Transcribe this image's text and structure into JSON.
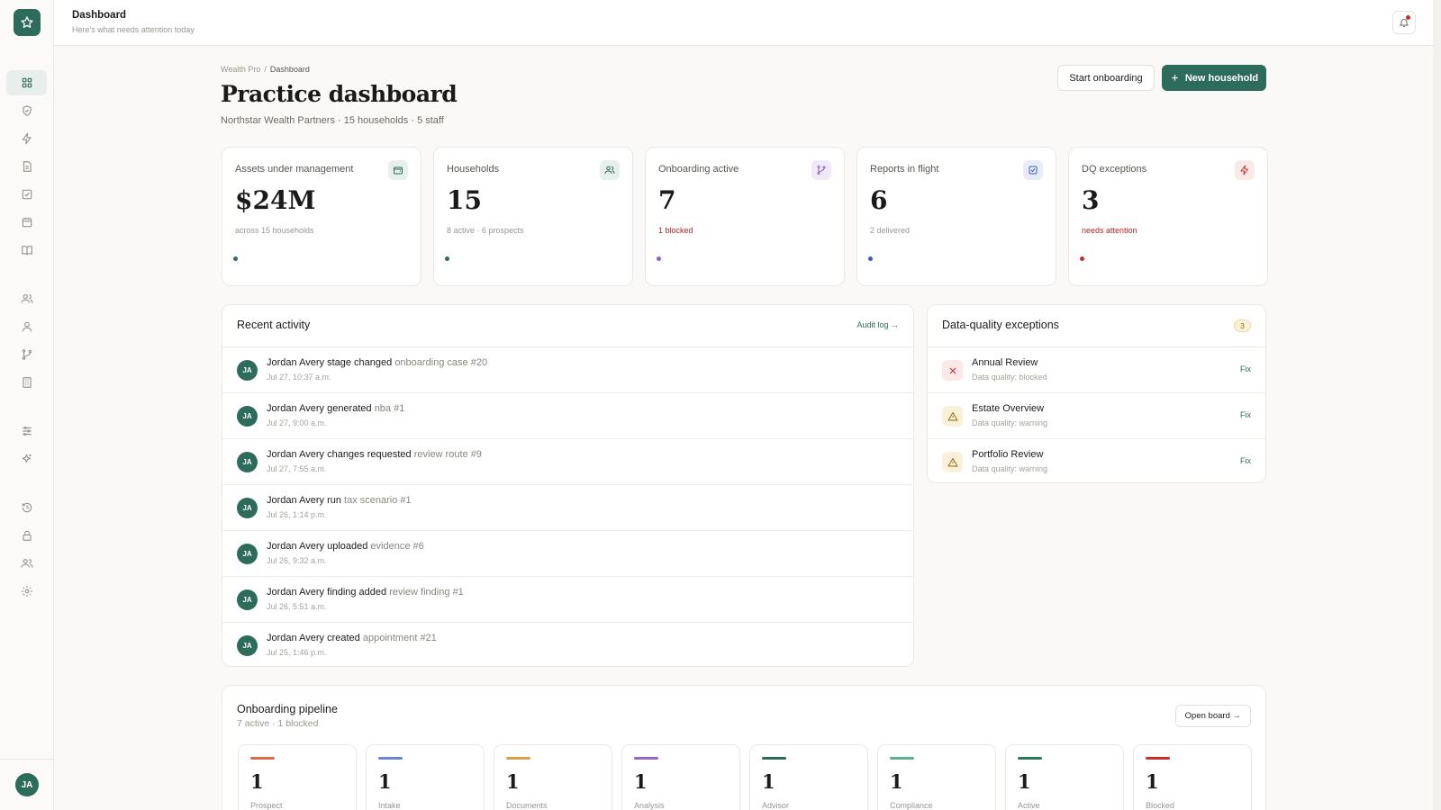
{
  "topbar": {
    "title": "Dashboard",
    "subtitle": "Here's what needs attention today"
  },
  "sidebar": {
    "items": [
      {
        "icon": "grid-icon"
      },
      {
        "icon": "shield-icon"
      },
      {
        "icon": "bolt-icon"
      },
      {
        "icon": "document-icon"
      },
      {
        "icon": "checkbox-icon"
      },
      {
        "icon": "calendar-icon"
      },
      {
        "icon": "book-icon"
      },
      {
        "icon": "users-icon"
      },
      {
        "icon": "user-icon"
      },
      {
        "icon": "branch-icon"
      },
      {
        "icon": "building-icon"
      },
      {
        "icon": "sliders-icon"
      },
      {
        "icon": "sparkles-icon"
      },
      {
        "icon": "history-icon"
      },
      {
        "icon": "lock-icon"
      },
      {
        "icon": "team-icon"
      },
      {
        "icon": "gear-icon"
      }
    ],
    "avatar_initials": "JA"
  },
  "header": {
    "breadcrumb": [
      "Wealth Pro",
      "Dashboard"
    ],
    "title": "Practice dashboard",
    "subtitle": "Northstar Wealth Partners · 15 households · 5 staff",
    "start_onboarding_label": "Start onboarding",
    "new_household_label": "New household"
  },
  "kpis": [
    {
      "label": "Assets under management",
      "value": "$24M",
      "note": "across 15 households",
      "accent": "#2d6b5a",
      "icon": "wallet-icon"
    },
    {
      "label": "Households",
      "value": "15",
      "note": "8 active · 6 prospects",
      "accent": "#2d6b5a",
      "icon": "users-icon"
    },
    {
      "label": "Onboarding active",
      "value": "7",
      "note": "1 blocked",
      "accent": "#8b63c9",
      "icon": "branch-icon"
    },
    {
      "label": "Reports in flight",
      "value": "6",
      "note": "2 delivered",
      "accent": "#3a5fc4",
      "icon": "checkbox-icon"
    },
    {
      "label": "DQ exceptions",
      "value": "3",
      "note": "needs attention",
      "accent": "#c9302c",
      "icon": "bolt-icon"
    }
  ],
  "activity": {
    "title": "Recent activity",
    "audit_link": "Audit log →",
    "items": [
      {
        "initials": "JA",
        "actor": "Jordan Avery",
        "action": "stage changed",
        "target": "onboarding case #20",
        "time": "Jul 27, 10:37 a.m."
      },
      {
        "initials": "JA",
        "actor": "Jordan Avery",
        "action": "generated",
        "target": "nba #1",
        "time": "Jul 27, 9:00 a.m."
      },
      {
        "initials": "JA",
        "actor": "Jordan Avery",
        "action": "changes requested",
        "target": "review route #9",
        "time": "Jul 27, 7:55 a.m."
      },
      {
        "initials": "JA",
        "actor": "Jordan Avery",
        "action": "run",
        "target": "tax scenario #1",
        "time": "Jul 26, 1:14 p.m."
      },
      {
        "initials": "JA",
        "actor": "Jordan Avery",
        "action": "uploaded",
        "target": "evidence #6",
        "time": "Jul 26, 9:32 a.m."
      },
      {
        "initials": "JA",
        "actor": "Jordan Avery",
        "action": "finding added",
        "target": "review finding #1",
        "time": "Jul 26, 5:51 a.m."
      },
      {
        "initials": "JA",
        "actor": "Jordan Avery",
        "action": "created",
        "target": "appointment #21",
        "time": "Jul 25, 1:46 p.m."
      }
    ]
  },
  "dq": {
    "title": "Data-quality exceptions",
    "count": "3",
    "fix_label": "Fix",
    "items": [
      {
        "name": "Annual Review",
        "status": "Data quality: blocked",
        "severity": "blocked",
        "icon": "x-icon"
      },
      {
        "name": "Estate Overview",
        "status": "Data quality: warning",
        "severity": "warning",
        "icon": "warning-icon"
      },
      {
        "name": "Portfolio Review",
        "status": "Data quality: warning",
        "severity": "warning",
        "icon": "warning-icon"
      }
    ]
  },
  "pipeline": {
    "title": "Onboarding pipeline",
    "subtitle": "7 active · 1 blocked",
    "open_board_label": "Open board →",
    "stages": [
      {
        "name": "Prospect",
        "count": "1",
        "color": "#d96a4a"
      },
      {
        "name": "Intake",
        "count": "1",
        "color": "#6a84d6"
      },
      {
        "name": "Documents",
        "count": "1",
        "color": "#d9a04a"
      },
      {
        "name": "Analysis",
        "count": "1",
        "color": "#9466c9"
      },
      {
        "name": "Advisor",
        "count": "1",
        "color": "#2d6b5a"
      },
      {
        "name": "Compliance",
        "count": "1",
        "color": "#5fb08e"
      },
      {
        "name": "Active",
        "count": "1",
        "color": "#2d7a55"
      },
      {
        "name": "Blocked",
        "count": "1",
        "color": "#c9302c"
      }
    ]
  }
}
